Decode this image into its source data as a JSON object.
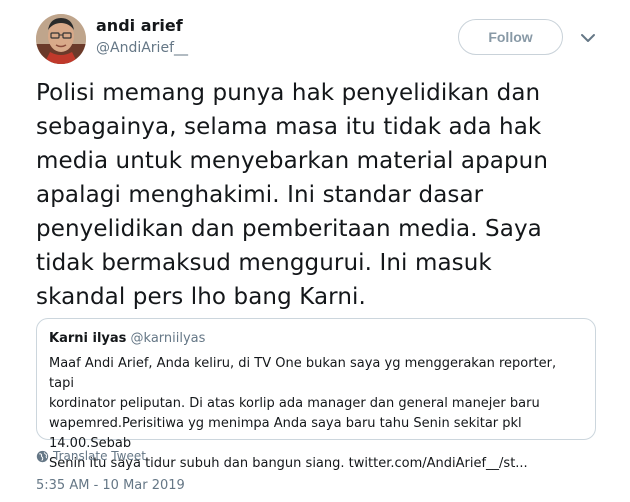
{
  "author": {
    "name": "andi arief",
    "handle": "@AndiArief__"
  },
  "actions": {
    "follow_label": "Follow",
    "menu_icon": "chevron-down-icon"
  },
  "tweet": {
    "text": "Polisi memang punya hak penyelidikan dan\nsebagainya, selama masa itu tidak ada hak\nmedia untuk menyebarkan material apapun\napalagi menghakimi. Ini standar dasar\npenyelidikan dan pemberitaan media. Saya\ntidak bermaksud menggurui. Ini masuk\nskandal pers lho bang Karni."
  },
  "quoted_tweet": {
    "name": "Karni ilyas",
    "handle": "@karniilyas",
    "text": "Maaf Andi Arief, Anda keliru, di TV One bukan saya yg menggerakan reporter, tapi\nkordinator peliputan. Di atas korlip ada manager dan general manejer baru\nwapemred.Perisitiwa yg menimpa Anda saya baru tahu Senin sekitar pkl 14.00.Sebab\nSenin itu saya tidur subuh dan bangun siang. twitter.com/AndiArief__/st..."
  },
  "translate": {
    "label": "Translate Tweet",
    "icon": "globe-icon"
  },
  "timestamp": "5:35 AM - 10 Mar 2019",
  "colors": {
    "text": "#14171a",
    "secondary": "#657786",
    "border": "#ccd6dd",
    "follow_text": "#8899a6"
  }
}
